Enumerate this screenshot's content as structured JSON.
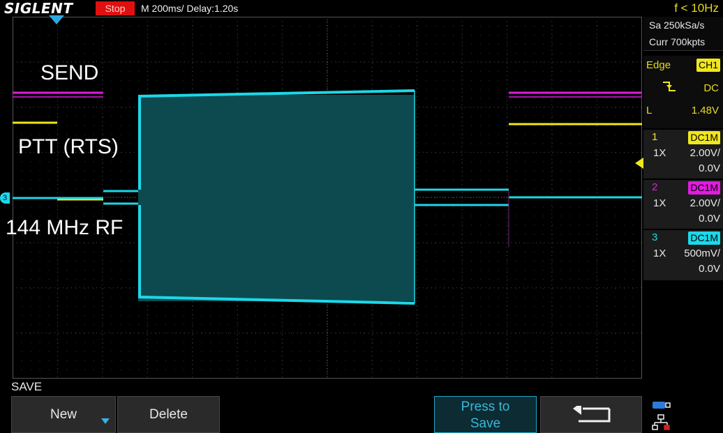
{
  "topbar": {
    "brand": "SIGLENT",
    "run_state": "Stop",
    "timebase": "M 200ms/  Delay:1.20s",
    "frequency": "f < 10Hz"
  },
  "acquisition": {
    "sample_rate": "Sa 250kSa/s",
    "memory": "Curr 700kpts"
  },
  "trigger": {
    "type": "Edge",
    "source": "CH1",
    "slope_icon": "falling-edge-icon",
    "coupling": "DC",
    "level_label": "L",
    "level": "1.48V"
  },
  "channels": [
    {
      "num": "1",
      "coupling": "DC1M",
      "probe": "1X",
      "scale": "2.00V/",
      "offset": "0.0V",
      "color": "#f0e61c"
    },
    {
      "num": "2",
      "coupling": "DC1M",
      "probe": "1X",
      "scale": "2.00V/",
      "offset": "0.0V",
      "color": "#e01ce0"
    },
    {
      "num": "3",
      "coupling": "DC1M",
      "probe": "1X",
      "scale": "500mV/",
      "offset": "0.0V",
      "color": "#1cd8e8"
    }
  ],
  "annotations": {
    "send": "SEND",
    "ptt": "PTT (RTS)",
    "rf": "144 MHz RF"
  },
  "menu": {
    "title": "SAVE",
    "new_label": "New",
    "delete_label": "Delete",
    "press_to_save_line1": "Press to",
    "press_to_save_line2": "Save"
  },
  "markers": {
    "ch3_marker": "3"
  }
}
